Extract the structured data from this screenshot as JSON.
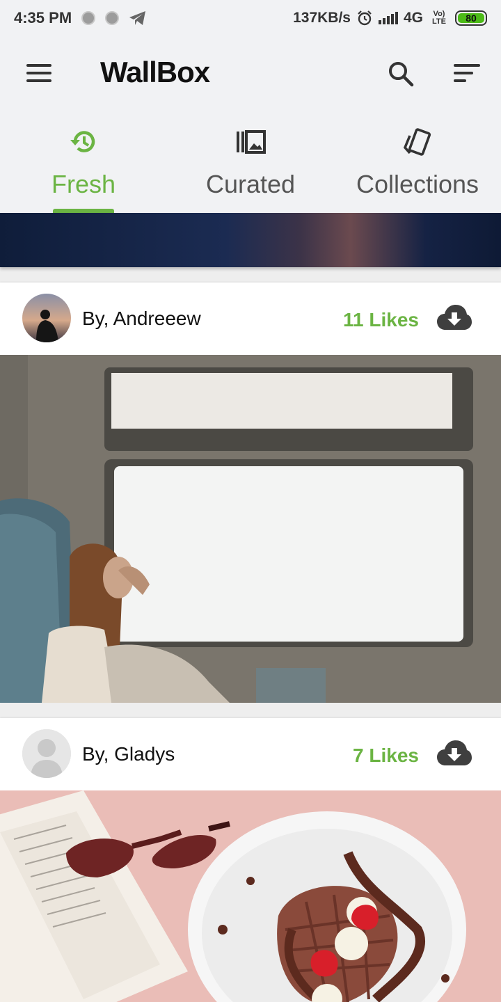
{
  "status": {
    "time": "4:35 PM",
    "speed": "137KB/s",
    "network": "4G",
    "volte": "Vo) LTE",
    "battery": "80"
  },
  "appbar": {
    "title": "WallBox",
    "icons": [
      "menu-icon",
      "search-icon",
      "sort-icon"
    ]
  },
  "tabs": [
    {
      "label": "Fresh",
      "icon": "history-icon",
      "active": true
    },
    {
      "label": "Curated",
      "icon": "gallery-icon",
      "active": false
    },
    {
      "label": "Collections",
      "icon": "collections-icon",
      "active": false
    }
  ],
  "posts": [
    {
      "author": "By, Andreeew",
      "likes": "11 Likes"
    },
    {
      "author": "By, Gladys",
      "likes": "7 Likes"
    }
  ],
  "colors": {
    "accent": "#6bb443",
    "background": "#f1f2f4",
    "icon": "#333333"
  }
}
